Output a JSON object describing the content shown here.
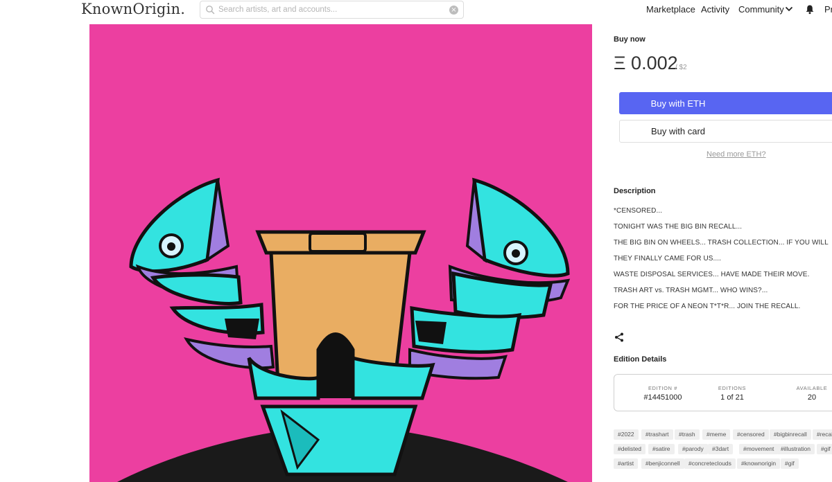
{
  "header": {
    "logo": "KnownOrigin.",
    "search_placeholder": "Search artists, art and accounts...",
    "nav": {
      "marketplace": "Marketplace",
      "activity": "Activity",
      "community": "Community",
      "profile": "Pr"
    }
  },
  "artwork": {
    "background_color": "#ec3fa0"
  },
  "purchase": {
    "buy_now_label": "Buy now",
    "price": "Ξ 0.002",
    "price_usd": "/ $2",
    "buy_eth_label": "Buy with ETH",
    "buy_card_label": "Buy with card",
    "need_eth_link": "Need more ETH?",
    "accent_color": "#5865f2"
  },
  "description": {
    "title": "Description",
    "lines": [
      "*CENSORED...",
      "TONIGHT WAS THE BIG BIN RECALL...",
      "THE BIG BIN ON WHEELS... TRASH COLLECTION... IF YOU WILL",
      "THEY FINALLY CAME FOR US....",
      "WASTE DISPOSAL SERVICES... HAVE MADE THEIR MOVE.",
      "TRASH ART vs. TRASH MGMT... WHO WINS?...",
      "FOR THE PRICE OF A NEON T*T*R... JOIN THE RECALL."
    ]
  },
  "edition": {
    "title": "Edition Details",
    "edition_number_label": "EDITION #",
    "edition_number": "#14451000",
    "editions_label": "EDITIONS",
    "editions": "1 of 21",
    "available_label": "AVAILABLE",
    "available": "20"
  },
  "tags": [
    [
      "#2022",
      "#trashart",
      "#trash",
      "#meme",
      "#censored",
      "#bigbinrecall",
      "#recall"
    ],
    [
      "#delisted",
      "#satire",
      "#parody",
      "#3dart",
      "#movement",
      "#illustration",
      "#gif"
    ],
    [
      "#artist",
      "#benjiconnell",
      "#concreteclouds",
      "#knownorigin",
      "#gif"
    ]
  ]
}
